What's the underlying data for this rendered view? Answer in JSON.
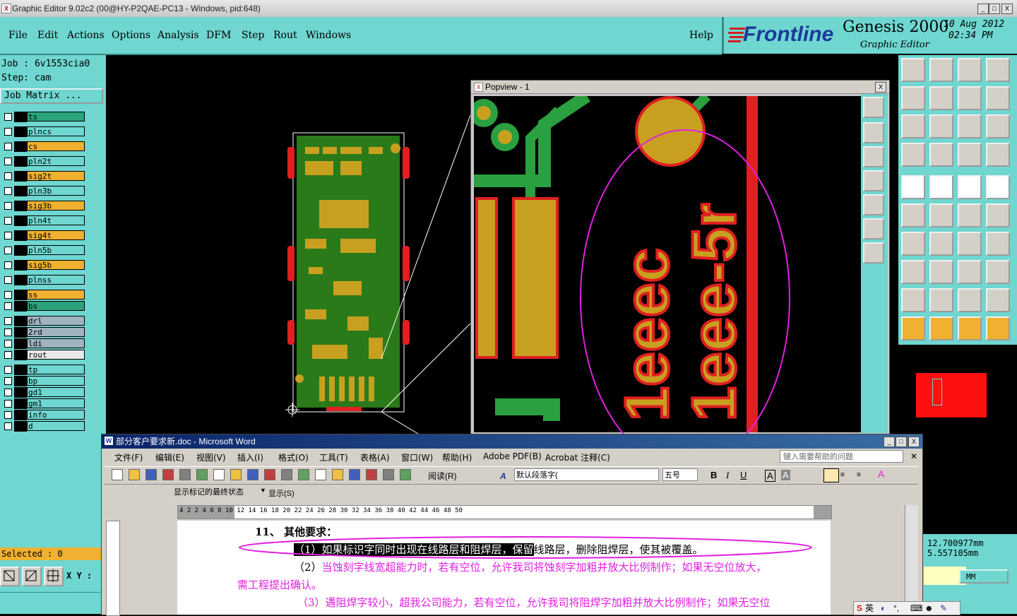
{
  "window": {
    "title": "Graphic Editor 9.02c2 (00@HY-P2QAE-PC13 - Windows, pid:648)",
    "icon_label": "X",
    "minimize": "_",
    "maximize": "□",
    "close": "X"
  },
  "menu": {
    "items": [
      "File",
      "Edit",
      "Actions",
      "Options",
      "Analysis",
      "DFM",
      "Step",
      "Rout",
      "Windows"
    ],
    "help": "Help"
  },
  "brand": {
    "logo": "Frontline",
    "product": "Genesis 2000",
    "subtitle": "Graphic Editor",
    "date": "10  Aug  2012",
    "time": "02:34  PM"
  },
  "left": {
    "job": "Job : 6v1553cia0",
    "step": "Step: cam",
    "matrix_button": "Job Matrix ...",
    "layers": [
      {
        "name": "ts",
        "color": "#2aa37a"
      },
      {
        "name": "plncs",
        "color": "#6fd6d0"
      },
      {
        "name": "cs",
        "color": "#f0b030"
      },
      {
        "name": "pln2t",
        "color": "#6fd6d0"
      },
      {
        "name": "sig2t",
        "color": "#f0b030"
      },
      {
        "name": "pln3b",
        "color": "#6fd6d0"
      },
      {
        "name": "sig3b",
        "color": "#f0b030"
      },
      {
        "name": "pln4t",
        "color": "#6fd6d0"
      },
      {
        "name": "sig4t",
        "color": "#f0b030"
      },
      {
        "name": "pln5b",
        "color": "#6fd6d0"
      },
      {
        "name": "sig5b",
        "color": "#f0b030"
      },
      {
        "name": "plnss",
        "color": "#6fd6d0"
      },
      {
        "name": "ss",
        "color": "#f0b030"
      },
      {
        "name": "bs",
        "color": "#2aa37a"
      },
      {
        "name": "drl",
        "color": "#a0b4c0"
      },
      {
        "name": "2rd",
        "color": "#a0b4c0"
      },
      {
        "name": "ldi",
        "color": "#a0b4c0"
      },
      {
        "name": "rout",
        "color": "#e8e8e8"
      },
      {
        "name": "tp",
        "color": "#6fd6d0"
      },
      {
        "name": "bp",
        "color": "#6fd6d0"
      },
      {
        "name": "gd1",
        "color": "#6fd6d0"
      },
      {
        "name": "gm1",
        "color": "#6fd6d0"
      },
      {
        "name": "info",
        "color": "#6fd6d0"
      },
      {
        "name": "d",
        "color": "#6fd6d0"
      }
    ],
    "selected": "Selected : 0",
    "xy_label": "X Y :"
  },
  "popview": {
    "title": "Popview - 1",
    "close": "X"
  },
  "coords": {
    "x": "12.700977mm",
    "y": "5.557105mm",
    "units": "MM"
  },
  "word": {
    "title": "部分客户要求新.doc - Microsoft Word",
    "menus": [
      "文件(F)",
      "编辑(E)",
      "视图(V)",
      "插入(I)",
      "格式(O)",
      "工具(T)",
      "表格(A)",
      "窗口(W)",
      "帮助(H)",
      "Adobe PDF(B)",
      "Acrobat 注释(C)"
    ],
    "help_placeholder": "键入需要帮助的问题",
    "read_button": "阅读(R)",
    "style_value": "默认段落字(",
    "size_value": "五号",
    "markup_value": "显示标记的最终状态",
    "show_button": "显示(S)",
    "heading": "11、 其他要求：",
    "para1_selected": "（1）如果标识字同时出现在线路层和阻焊层，保留",
    "para1_rest": "线路层，删除阻焊层，使其被覆盖。",
    "para2_a": "（2）",
    "para2_b": "当蚀刻字线宽超能力时，若有空位，允许我司将蚀刻字加粗并放大比例制作；如果无空位放大，",
    "para2_c": "需工程提出确认。",
    "para3": "（3）遇阻焊字较小，超我公司能力，若有空位，允许我司将阻焊字加粗并放大比例制作；如果无空位",
    "ruler": "4  2     2  4  6  8  10  12  14  16  18  20  22  24  26  28  30  32  34  36  38  40  42  44  46  48  50"
  },
  "taskbar": {
    "ime": "英"
  }
}
